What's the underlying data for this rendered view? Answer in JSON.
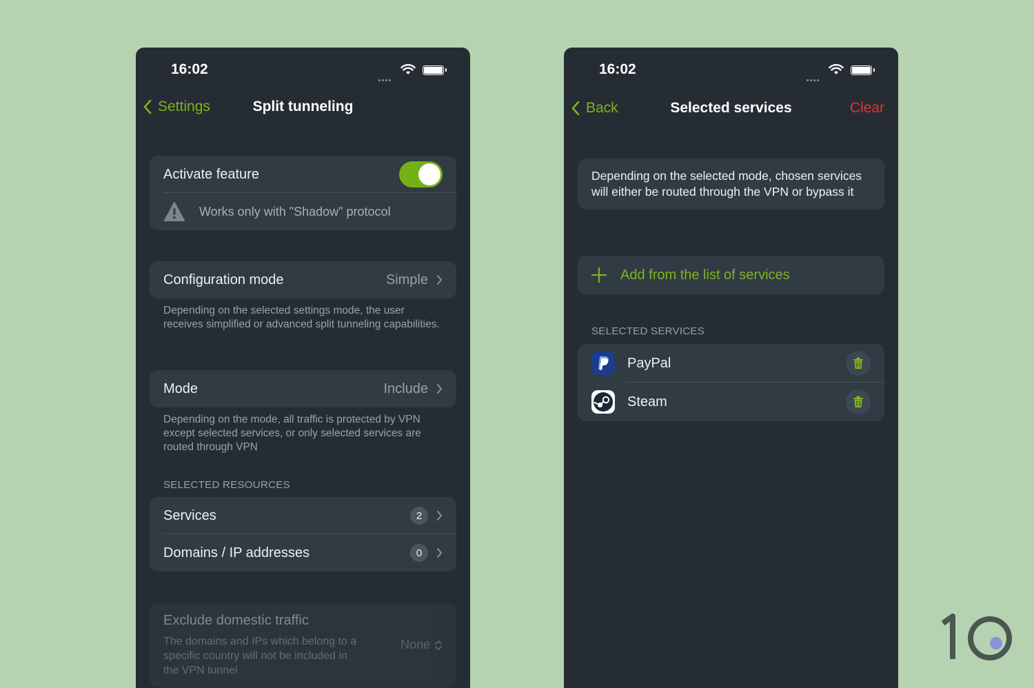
{
  "left_screen": {
    "status": {
      "time": "16:02"
    },
    "nav": {
      "back_label": "Settings",
      "title": "Split tunneling"
    },
    "activate": {
      "label": "Activate feature",
      "enabled": true,
      "warning": "Works only with \"Shadow\" protocol"
    },
    "config_mode": {
      "label": "Configuration mode",
      "value": "Simple",
      "help": "Depending on the selected settings mode, the user receives simplified or advanced split tunneling capabilities."
    },
    "mode": {
      "label": "Mode",
      "value": "Include",
      "help": "Depending on the mode, all traffic is protected by VPN except selected services, or only selected services are routed through VPN"
    },
    "resources": {
      "header": "SELECTED RESOURCES",
      "items": [
        {
          "label": "Services",
          "count": "2"
        },
        {
          "label": "Domains / IP addresses",
          "count": "0"
        }
      ]
    },
    "domestic": {
      "title": "Exclude domestic traffic",
      "description": "The domains and IPs which belong to a specific country will not be included in the VPN tunnel",
      "value": "None"
    }
  },
  "right_screen": {
    "status": {
      "time": "16:02"
    },
    "nav": {
      "back_label": "Back",
      "title": "Selected services",
      "action_label": "Clear"
    },
    "info": "Depending on the selected mode, chosen services will either be routed through the VPN or bypass it",
    "add_label": "Add from the list of services",
    "services_header": "SELECTED SERVICES",
    "services": [
      {
        "name": "PayPal",
        "icon": "paypal-icon"
      },
      {
        "name": "Steam",
        "icon": "steam-icon"
      }
    ]
  },
  "colors": {
    "background": "#b5d3b0",
    "screen": "#262c33",
    "card": "#313b44",
    "accent_green": "#7fb51d",
    "danger_red": "#e9302d"
  }
}
